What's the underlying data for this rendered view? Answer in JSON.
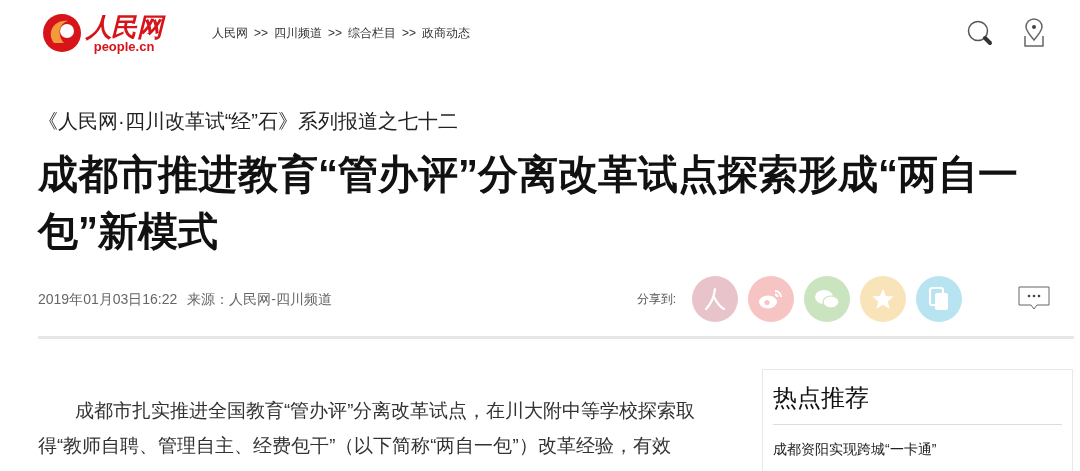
{
  "header": {
    "logo": {
      "name": "人民网",
      "domain": "people.cn"
    },
    "breadcrumb": [
      {
        "label": "人民网"
      },
      {
        "label": "四川频道"
      },
      {
        "label": "综合栏目"
      },
      {
        "label": "政商动态"
      }
    ],
    "separator": ">>"
  },
  "article": {
    "series": "《人民网·四川改革试“经”石》系列报道之七十二",
    "title": "成都市推进教育“管办评”分离改革试点探索形成“两自一包”新模式",
    "date": "2019年01月03日16:22",
    "source": "来源：人民网-四川频道",
    "share_label": "分享到:",
    "share": [
      {
        "kind": "people",
        "color": "#e8c4ca"
      },
      {
        "kind": "weibo",
        "color": "#f7c4c4"
      },
      {
        "kind": "wechat",
        "color": "#c9e4be"
      },
      {
        "kind": "qzone",
        "color": "#f9e4ba"
      },
      {
        "kind": "copy",
        "color": "#b8e3f1"
      }
    ],
    "body": "成都市扎实推进全国教育“管办评”分离改革试点，在川大附中等学校探索取得“教师自聘、管理自主、经费包干”（以下简称“两自一包”）改革经验，有效"
  },
  "sidebar": {
    "title": "热点推荐",
    "items": [
      {
        "label": "成都资阳实现跨城“一卡通”"
      }
    ]
  }
}
